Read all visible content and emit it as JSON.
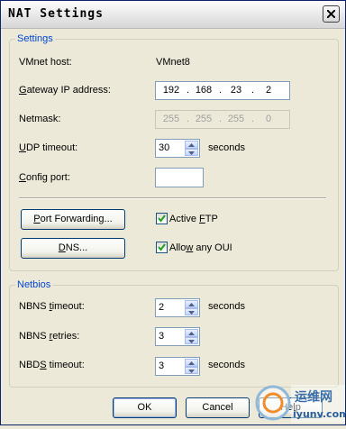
{
  "window": {
    "title": "NAT Settings"
  },
  "settings": {
    "legend": "Settings",
    "vmnet_host_label": "VMnet host:",
    "vmnet_host_value": "VMnet8",
    "gateway": {
      "label_pre": "",
      "label_accel": "G",
      "label_post": "ateway IP address:",
      "octets": [
        "192",
        "168",
        "23",
        "2"
      ]
    },
    "netmask": {
      "label": "Netmask:",
      "octets": [
        "255",
        "255",
        "255",
        "0"
      ]
    },
    "udp_timeout": {
      "label_accel": "U",
      "label_post": "DP timeout:",
      "value": "30",
      "unit": "seconds"
    },
    "config_port": {
      "label_pre": "",
      "label_accel": "C",
      "label_post": "onfig port:",
      "value": ""
    },
    "port_forwarding_button": {
      "pre": "",
      "accel": "P",
      "post": "ort Forwarding..."
    },
    "dns_button": {
      "pre": "",
      "accel": "D",
      "post": "NS..."
    },
    "active_ftp": {
      "pre": "Active ",
      "accel": "F",
      "post": "TP",
      "checked": true
    },
    "allow_any_oui": {
      "pre": "Allo",
      "accel": "w",
      "post": " any OUI",
      "checked": true
    }
  },
  "netbios": {
    "legend": "Netbios",
    "nbns_timeout": {
      "pre": "NBNS ",
      "accel": "t",
      "post": "imeout:",
      "value": "2",
      "unit": "seconds"
    },
    "nbns_retries": {
      "pre": "NBNS ",
      "accel": "r",
      "post": "etries:",
      "value": "3"
    },
    "nbds_timeout": {
      "pre": "NBD",
      "accel": "S",
      "post": " timeout:",
      "value": "3",
      "unit": "seconds"
    }
  },
  "footer": {
    "ok_label": "OK",
    "cancel_label": "Cancel",
    "help_label": "Help"
  },
  "watermark": {
    "text_cn": "运维网",
    "text_url": "iyunv.com"
  }
}
